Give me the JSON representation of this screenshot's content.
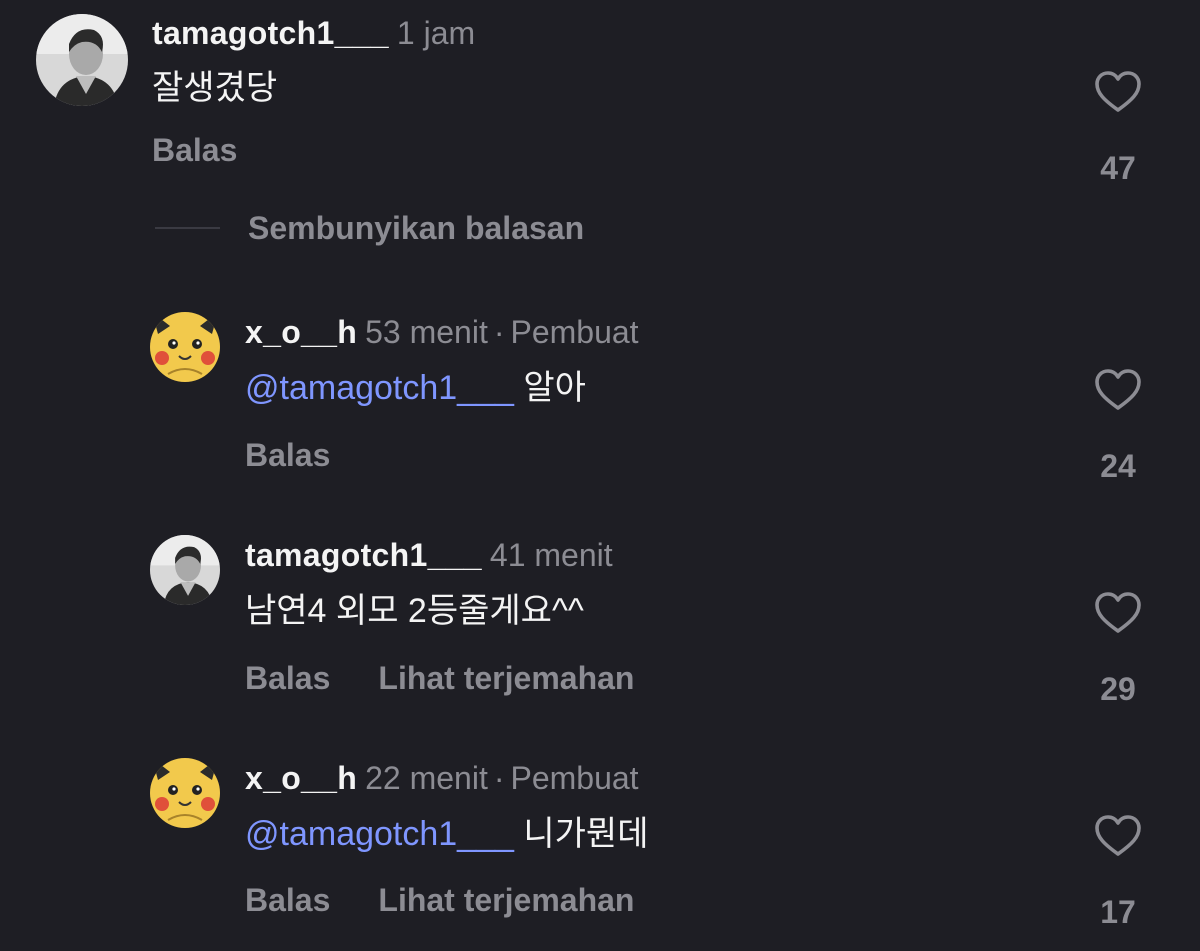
{
  "comments": [
    {
      "username": "tamagotch1___",
      "time": "1 jam",
      "tag": "",
      "mention": "",
      "text": "잘생겼당",
      "reply_label": "Balas",
      "translate_label": "",
      "likes": "47",
      "avatar": "person-photo-avatar"
    }
  ],
  "hide_replies_label": "Sembunyikan balasan",
  "replies": [
    {
      "username": "x_o__h",
      "time": "53 menit",
      "separator": "·",
      "tag": "Pembuat",
      "mention": "@tamagotch1___",
      "text": "알아",
      "reply_label": "Balas",
      "translate_label": "",
      "likes": "24",
      "avatar": "pikachu-avatar"
    },
    {
      "username": "tamagotch1___",
      "time": "41 menit",
      "separator": "",
      "tag": "",
      "mention": "",
      "text": "남연4 외모 2등줄게요^^",
      "reply_label": "Balas",
      "translate_label": "Lihat terjemahan",
      "likes": "29",
      "avatar": "person-photo-avatar"
    },
    {
      "username": "x_o__h",
      "time": "22 menit",
      "separator": "·",
      "tag": "Pembuat",
      "mention": "@tamagotch1___",
      "text": "니가뭔데",
      "reply_label": "Balas",
      "translate_label": "Lihat terjemahan",
      "likes": "17",
      "avatar": "pikachu-avatar"
    }
  ],
  "colors": {
    "background": "#1e1e24",
    "text_primary": "#f4f4f4",
    "text_secondary": "#8c8c93",
    "mention": "#7f96ff"
  },
  "icons": {
    "like": "heart-outline-icon"
  }
}
